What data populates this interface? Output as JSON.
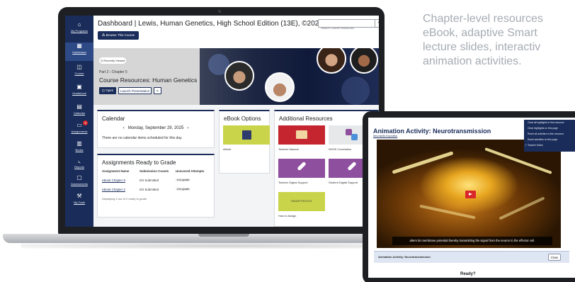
{
  "laptop": {
    "sidebar": [
      {
        "label": "My Programs",
        "icon": "home-icon",
        "glyph": "⌂"
      },
      {
        "label": "Dashboard",
        "icon": "dashboard-icon",
        "glyph": "▦",
        "active": true
      },
      {
        "label": "Course",
        "icon": "book-icon",
        "glyph": "◫"
      },
      {
        "label": "Gradebook",
        "icon": "gradebook-icon",
        "glyph": "▣"
      },
      {
        "label": "Calendar",
        "icon": "calendar-icon",
        "glyph": "▤"
      },
      {
        "label": "Assignments",
        "icon": "assignments-icon",
        "glyph": "▭",
        "badge": "3"
      },
      {
        "label": "Books",
        "icon": "books-icon",
        "glyph": "▥"
      },
      {
        "label": "Reports",
        "icon": "reports-icon",
        "glyph": "⌞"
      },
      {
        "label": "Assessments",
        "icon": "assessments-icon",
        "glyph": "▢"
      },
      {
        "label": "My Tools",
        "icon": "tools-icon",
        "glyph": "⚒"
      }
    ],
    "header": {
      "title": "Dashboard | Lewis, Human Genetics, High School Edition (13E), ©2021",
      "search_placeholder": "Search Course Resources",
      "browse_label": "⁂ Browse This Course"
    },
    "hero": {
      "badge": "◷ Recently Viewed",
      "breadcrumb": "Part 2 › Chapter 5",
      "course_title": "Course Resources: Human Genetics",
      "open_label": "◫ Open",
      "launch_label": "Launch Presentation",
      "edit_label": "✎"
    },
    "calendar": {
      "title": "Calendar",
      "date": "Monday, September 29, 2025",
      "prev": "‹",
      "next": "›",
      "empty": "There are no calendar items scheduled for this day."
    },
    "assignments": {
      "title": "Assignments Ready to Grade",
      "columns": [
        "Assignment Name",
        "Submission Counts",
        "Unscored Attempts"
      ],
      "rows": [
        {
          "name": "eBook Chapter 9",
          "count": "0/4 Submitted",
          "status": "4 to grade"
        },
        {
          "name": "eBook Chapter 2",
          "count": "0/4 Submitted",
          "status": "4 to grade"
        }
      ],
      "footer": "Displaying 2 out of 2 ready to grade"
    },
    "ebook": {
      "title": "eBook Options",
      "item": "eBook"
    },
    "resources": {
      "title": "Additional Resources",
      "items": [
        "Teacher Manual",
        "NGSS Correlation",
        "Teacher Digital Support",
        "Student Digital Support",
        "How to Assign"
      ],
      "smartbook_text": "SMARTBOOK"
    }
  },
  "caption": {
    "lines": [
      "Chapter-level resources",
      "eBook, adaptive Smart",
      "lecture slides, interactiv",
      "animation activities."
    ]
  },
  "tablet": {
    "title": "Animation Activity: Neurotransmission",
    "subtitle": "Neuroskills Exposition",
    "menu": [
      "Clear all highlights in this resource",
      "Clear highlights on this page",
      "Reset all activities in this resource",
      "Reset activities on this page",
      "Teacher Notes"
    ],
    "caption_text": "alters its membrane potential thereby transmitting the signal from the neuron to the effector cell.",
    "bar_label": "Animation Activity: Neurotransmission",
    "close_label": "Close",
    "ready_label": "Ready?"
  },
  "colors": {
    "navy": "#1a2d5a",
    "accent_red": "#d9262b",
    "caption_gray": "#a6abb3",
    "tile_green": "#c9d44a",
    "tile_purple": "#8e4f9e",
    "tile_red": "#c4252f"
  }
}
